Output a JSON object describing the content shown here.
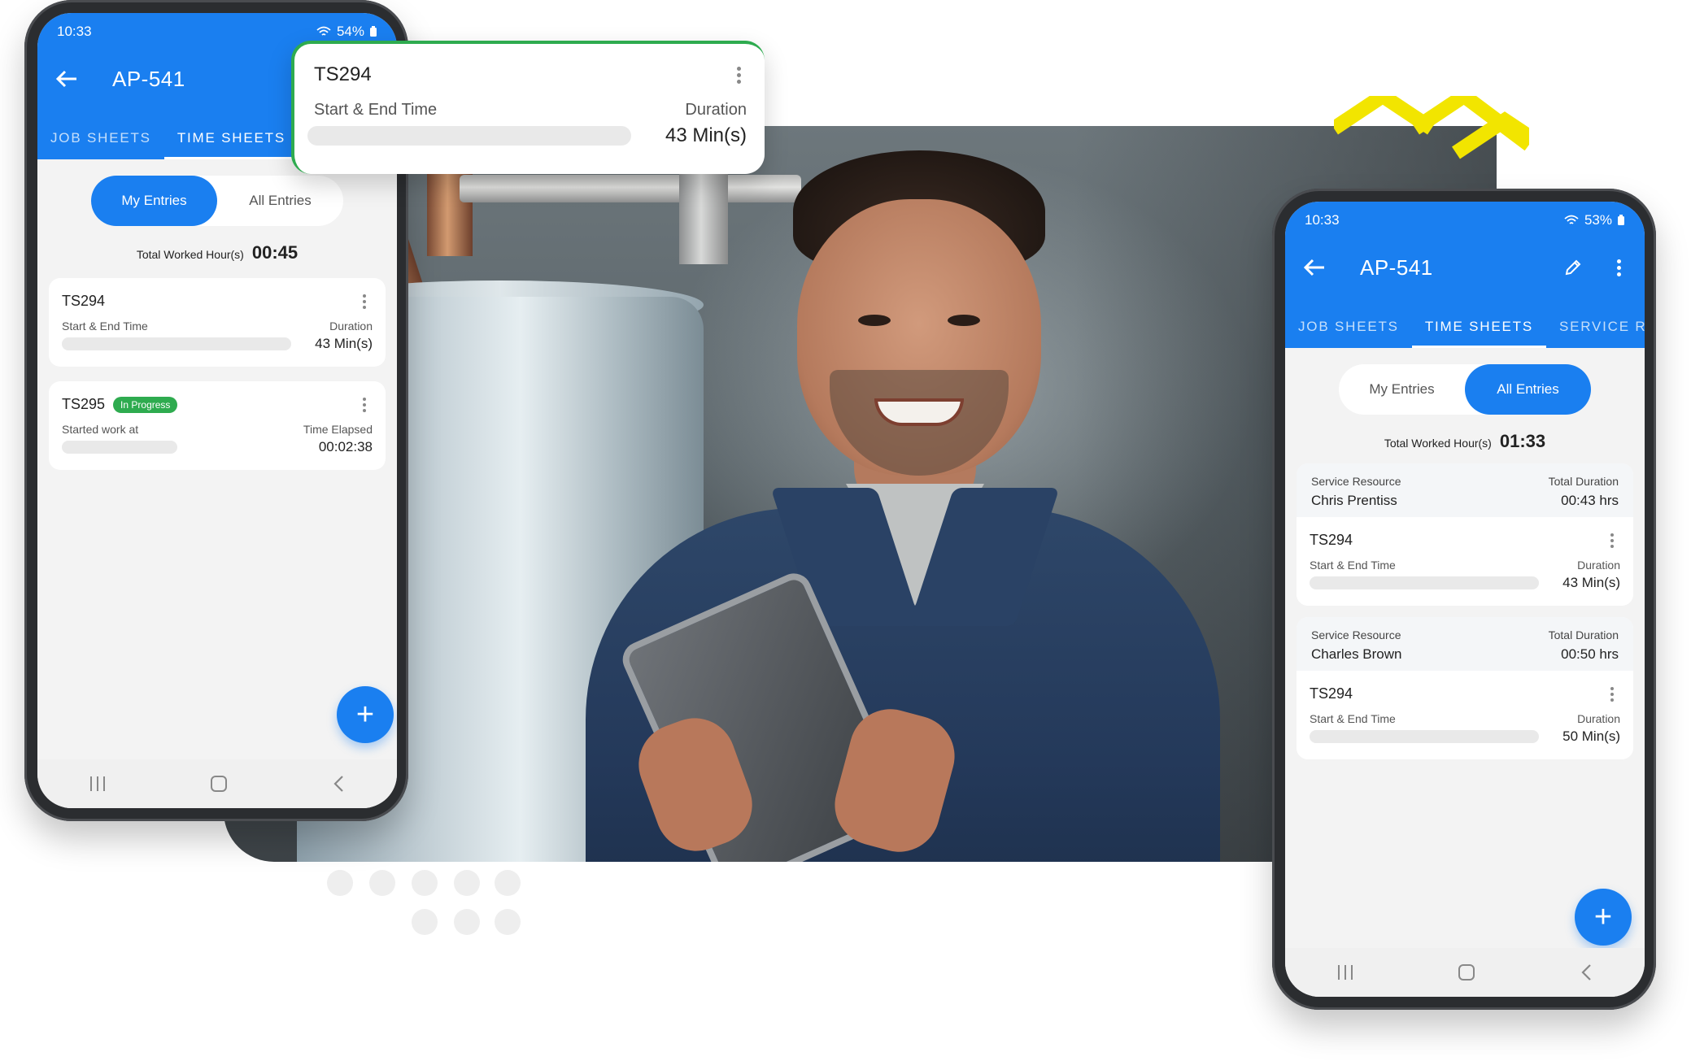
{
  "left_phone": {
    "time": "10:33",
    "battery": "54%",
    "title": "AP-541",
    "tabs": [
      "JOB SHEETS",
      "TIME SHEETS"
    ],
    "segment": {
      "mine": "My Entries",
      "all": "All Entries"
    },
    "total_label": "Total Worked Hour(s)",
    "total_value": "00:45",
    "entries": [
      {
        "id": "TS294",
        "left_label": "Start & End Time",
        "right_label": "Duration",
        "value": "43 Min(s)"
      },
      {
        "id": "TS295",
        "badge": "In Progress",
        "left_label": "Started work at",
        "right_label": "Time Elapsed",
        "value": "00:02:38"
      }
    ],
    "fab": "+"
  },
  "floating_card": {
    "id": "TS294",
    "left_label": "Start & End Time",
    "right_label": "Duration",
    "value": "43 Min(s)"
  },
  "right_phone": {
    "time": "10:33",
    "battery": "53%",
    "title": "AP-541",
    "tabs": [
      "JOB SHEETS",
      "TIME SHEETS",
      "SERVICE REPO"
    ],
    "segment": {
      "mine": "My Entries",
      "all": "All Entries"
    },
    "total_label": "Total Worked Hour(s)",
    "total_value": "01:33",
    "groups": [
      {
        "resource_label": "Service Resource",
        "resource": "Chris Prentiss",
        "duration_label": "Total Duration",
        "duration": "00:43 hrs",
        "entry": {
          "id": "TS294",
          "left_label": "Start & End Time",
          "right_label": "Duration",
          "value": "43 Min(s)"
        }
      },
      {
        "resource_label": "Service Resource",
        "resource": "Charles Brown",
        "duration_label": "Total Duration",
        "duration": "00:50 hrs",
        "entry": {
          "id": "TS294",
          "left_label": "Start & End Time",
          "right_label": "Duration",
          "value": "50 Min(s)"
        }
      }
    ],
    "fab": "+"
  },
  "colors": {
    "primary": "#1a7ff0",
    "success": "#2eab4f",
    "accent": "#f2e500"
  }
}
